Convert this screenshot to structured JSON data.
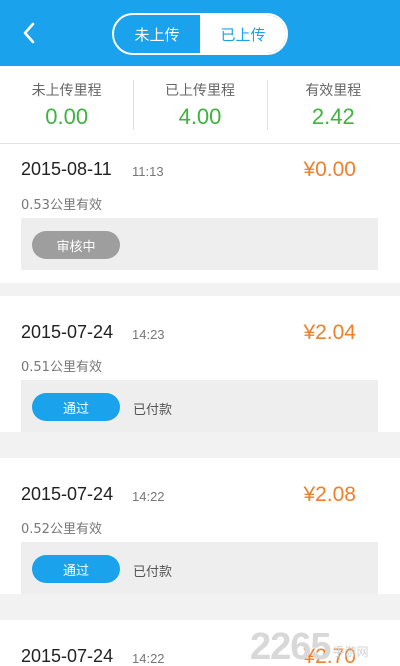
{
  "header": {
    "tabs": [
      {
        "label": "未上传",
        "active": false
      },
      {
        "label": "已上传",
        "active": true
      }
    ],
    "accent_color": "#1aa2ec"
  },
  "stats": [
    {
      "label": "未上传里程",
      "value": "0.00"
    },
    {
      "label": "已上传里程",
      "value": "4.00"
    },
    {
      "label": "有效里程",
      "value": "2.42"
    }
  ],
  "records": [
    {
      "date": "2015-08-11",
      "time": "11:13",
      "amount": "¥0.00",
      "distance": "0.53公里有效",
      "status": "审核中",
      "payment": ""
    },
    {
      "date": "2015-07-24",
      "time": "14:23",
      "amount": "¥2.04",
      "distance": "0.51公里有效",
      "status": "通过",
      "payment": "已付款"
    },
    {
      "date": "2015-07-24",
      "time": "14:22",
      "amount": "¥2.08",
      "distance": "0.52公里有效",
      "status": "通过",
      "payment": "已付款"
    },
    {
      "date": "2015-07-24",
      "time": "14:22",
      "amount": "¥2.70",
      "distance": "",
      "status": "",
      "payment": ""
    }
  ],
  "watermark": {
    "number": "2265",
    "text": "手游网"
  }
}
